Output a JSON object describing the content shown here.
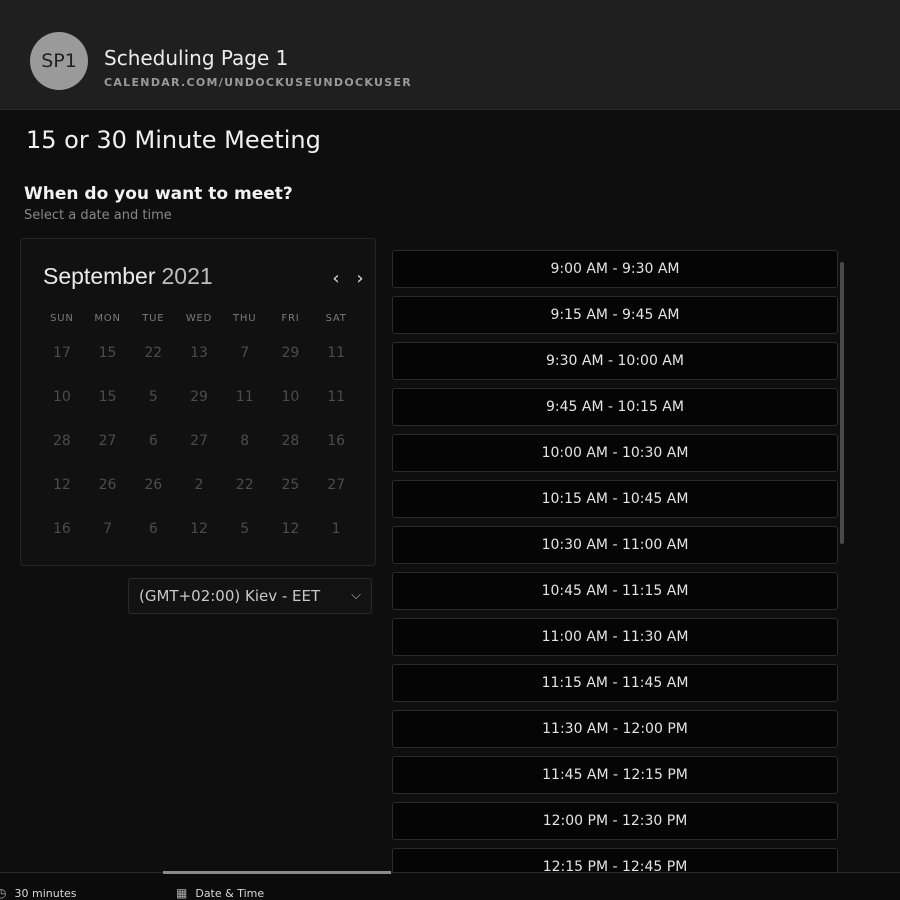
{
  "header": {
    "avatar_initials": "SP1",
    "page_name": "Scheduling Page 1",
    "page_url": "CALENDAR.COM/UNDOCKUSEUNDOCKUSER"
  },
  "meeting": {
    "title": "15 or 30 Minute Meeting",
    "question": "When do you want to meet?",
    "subquestion": "Select a date and time"
  },
  "calendar": {
    "month": "September",
    "year": "2021",
    "prev_icon": "chevron-left-icon",
    "next_icon": "chevron-right-icon",
    "weekdays": [
      "SUN",
      "MON",
      "TUE",
      "WED",
      "THU",
      "FRI",
      "SAT"
    ],
    "weeks": [
      [
        "17",
        "15",
        "22",
        "13",
        "7",
        "29",
        "11"
      ],
      [
        "10",
        "15",
        "5",
        "29",
        "11",
        "10",
        "11"
      ],
      [
        "28",
        "27",
        "6",
        "27",
        "8",
        "28",
        "16"
      ],
      [
        "12",
        "26",
        "26",
        "2",
        "22",
        "25",
        "27"
      ],
      [
        "16",
        "7",
        "6",
        "12",
        "5",
        "12",
        "1"
      ]
    ]
  },
  "timezone": {
    "value": "(GMT+02:00) Kiev - EET",
    "chevron_icon": "chevron-down-icon"
  },
  "time_slots": [
    "9:00 AM - 9:30 AM",
    "9:15 AM - 9:45 AM",
    "9:30 AM - 10:00 AM",
    "9:45 AM - 10:15 AM",
    "10:00 AM - 10:30 AM",
    "10:15 AM - 10:45 AM",
    "10:30 AM - 11:00 AM",
    "10:45 AM - 11:15 AM",
    "11:00 AM - 11:30 AM",
    "11:15 AM - 11:45 AM",
    "11:30 AM - 12:00 PM",
    "11:45 AM - 12:15 PM",
    "12:00 PM - 12:30 PM",
    "12:15 PM - 12:45 PM"
  ],
  "footer": {
    "duration_label": "30 minutes",
    "duration_icon": "clock-icon",
    "datetime_label": "Date & Time",
    "datetime_icon": "calendar-icon"
  }
}
